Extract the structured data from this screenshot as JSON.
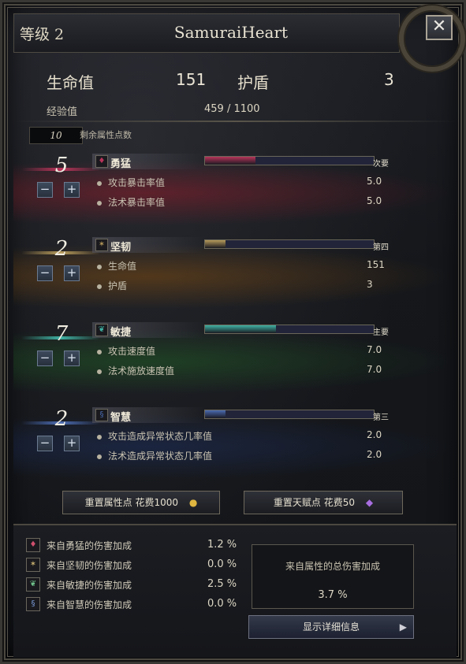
{
  "header": {
    "level": "等级 2",
    "name": "SamuraiHeart",
    "close_icon": "close-x-icon"
  },
  "stats": {
    "hp_label": "生命值",
    "hp_value": "151",
    "armor_label": "护盾",
    "armor_value": "3",
    "xp_label": "经验值",
    "xp_value": "459  /  1100"
  },
  "points": {
    "remaining": "10",
    "label": "剩余属性点数"
  },
  "attributes": [
    {
      "value": "5",
      "name": "勇猛",
      "icon": "strength-gem-icon",
      "rank": "次要",
      "bar_fill": 0.3,
      "color": "#b8345a",
      "glow": "#8b1c2a",
      "rows": [
        {
          "label": "攻击暴击率值",
          "value": "5.0"
        },
        {
          "label": "法术暴击率值",
          "value": "5.0"
        }
      ]
    },
    {
      "value": "2",
      "name": "坚韧",
      "icon": "fortitude-rune-icon",
      "rank": "第四",
      "bar_fill": 0.12,
      "color": "#b69a5a",
      "glow": "#7a4a12",
      "rows": [
        {
          "label": "生命值",
          "value": "151"
        },
        {
          "label": "护盾",
          "value": "3"
        }
      ]
    },
    {
      "value": "7",
      "name": "敏捷",
      "icon": "agility-leaf-icon",
      "rank": "主要",
      "bar_fill": 0.42,
      "color": "#3fb1a3",
      "glow": "#1f5a24",
      "rows": [
        {
          "label": "攻击速度值",
          "value": "7.0"
        },
        {
          "label": "法术施放速度值",
          "value": "7.0"
        }
      ]
    },
    {
      "value": "2",
      "name": "智慧",
      "icon": "wisdom-spiral-icon",
      "rank": "第三",
      "bar_fill": 0.12,
      "color": "#4a6ab0",
      "glow": "#1c2d5a",
      "rows": [
        {
          "label": "攻击造成异常状态几率值",
          "value": "2.0"
        },
        {
          "label": "法术造成异常状态几率值",
          "value": "2.0"
        }
      ]
    }
  ],
  "reset": {
    "attr_label": "重置属性点 花费1000",
    "talent_label": "重置天赋点 花费50",
    "gold_icon": "gold-coin-icon",
    "gem_icon": "purple-gem-icon"
  },
  "bonuses": [
    {
      "icon": "strength-gem-icon",
      "label": "来自勇猛的伤害加成",
      "value": "1.2 %"
    },
    {
      "icon": "fortitude-rune-icon",
      "label": "来自坚韧的伤害加成",
      "value": "0.0 %"
    },
    {
      "icon": "agility-leaf-icon",
      "label": "来自敏捷的伤害加成",
      "value": "2.5 %"
    },
    {
      "icon": "wisdom-spiral-icon",
      "label": "来自智慧的伤害加成",
      "value": "0.0 %"
    }
  ],
  "total": {
    "label": "来自属性的总伤害加成",
    "value": "3.7 %"
  },
  "detail_button": "显示详细信息"
}
